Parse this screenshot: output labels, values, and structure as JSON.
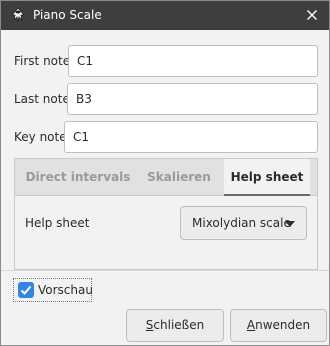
{
  "window": {
    "title": "Piano Scale"
  },
  "fields": {
    "first_note": {
      "label": "First note",
      "value": "C1"
    },
    "last_note": {
      "label": "Last note",
      "value": "B3"
    },
    "key_note": {
      "label": "Key note",
      "value": "C1"
    }
  },
  "tabs": [
    {
      "label": "Direct intervals",
      "active": false
    },
    {
      "label": "Skalieren",
      "active": false
    },
    {
      "label": "Help sheet",
      "active": true
    }
  ],
  "help_page": {
    "label": "Help sheet",
    "selected_scale": "Mixolydian scale"
  },
  "preview": {
    "label": "Vorschau",
    "checked": true
  },
  "buttons": {
    "close_label_first": "S",
    "close_label_rest": "chließen",
    "apply_label_first": "A",
    "apply_label_rest": "nwenden"
  },
  "colors": {
    "titlebar": "#3e3e3e",
    "accent": "#3584e4",
    "window_bg": "#f2f2f2"
  },
  "icons": {
    "app": "inkscape-app-icon",
    "close": "close-icon",
    "dropdown": "triangle-down-icon",
    "check": "checkmark-icon"
  }
}
